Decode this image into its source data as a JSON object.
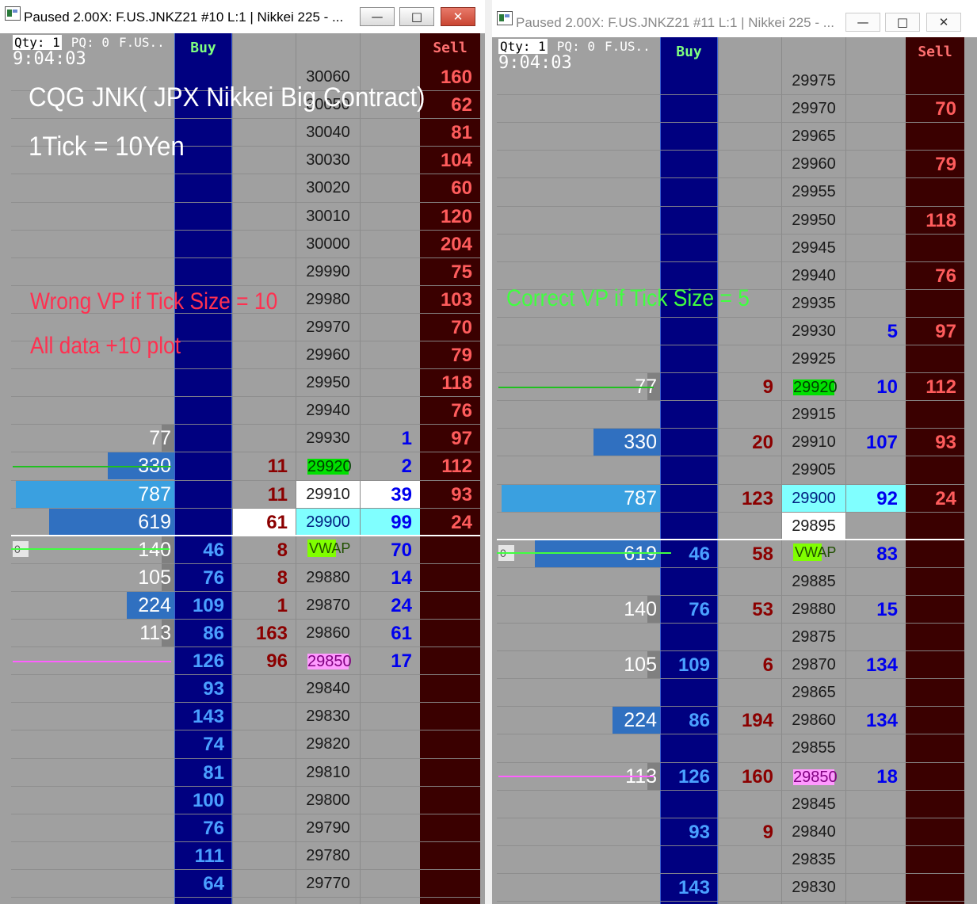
{
  "left": {
    "title": "Paused 2.00X: F.US.JNKZ21  #10 L:1 | Nikkei 225 - ...",
    "qty": "Qty: 1",
    "pq": "PQ: 0",
    "symbol": "F.US..",
    "clock": "9:04:03",
    "buy_label": "Buy",
    "sell_label": "Sell",
    "overlay_title": "CQG JNK( JPX Nikkei Big Contract)",
    "overlay_tick": "1Tick = 10Yen",
    "overlay_wrong": "Wrong VP if Tick Size = 10",
    "overlay_plot": "All data +10 plot",
    "rows": [
      {
        "price": "30060",
        "sell": "160"
      },
      {
        "price": "30050",
        "sell": "62"
      },
      {
        "price": "30040",
        "sell": "81"
      },
      {
        "price": "30030",
        "sell": "104"
      },
      {
        "price": "30020",
        "sell": "60"
      },
      {
        "price": "30010",
        "sell": "120"
      },
      {
        "price": "30000",
        "sell": "204"
      },
      {
        "price": "29990",
        "sell": "75"
      },
      {
        "price": "29980",
        "sell": "103"
      },
      {
        "price": "29970",
        "sell": "70"
      },
      {
        "price": "29960",
        "sell": "79"
      },
      {
        "price": "29950",
        "sell": "118"
      },
      {
        "price": "29940",
        "sell": "76"
      },
      {
        "price": "29930",
        "sell": "97",
        "ask": "1",
        "vol": "77",
        "vol_frac": 0.0
      },
      {
        "price": "29920",
        "sell": "112",
        "ask": "2",
        "bidtr": "11",
        "vol": "330",
        "vol_frac": 0.42,
        "hl": "green"
      },
      {
        "price": "29910",
        "sell": "93",
        "ask": "39",
        "bidtr": "11",
        "vol": "787",
        "vol_frac": 1.0,
        "hl": "white"
      },
      {
        "price": "29900",
        "sell": "24",
        "ask": "99",
        "bidtr": "61",
        "vol": "619",
        "vol_frac": 0.79,
        "hl": "cyan"
      },
      {
        "price": "VWAP",
        "ask": "70",
        "bidtr": "8",
        "buy": "46",
        "vol": "140",
        "vol_frac": 0.0,
        "hl": "vwap",
        "zero": "0"
      },
      {
        "price": "29880",
        "ask": "14",
        "bidtr": "8",
        "buy": "76",
        "vol": "105",
        "vol_frac": 0.0
      },
      {
        "price": "29870",
        "ask": "24",
        "bidtr": "1",
        "buy": "109",
        "vol": "224",
        "vol_frac": 0.28
      },
      {
        "price": "29860",
        "ask": "61",
        "bidtr": "163",
        "buy": "86",
        "vol": "113",
        "vol_frac": 0.0
      },
      {
        "price": "29850",
        "ask": "17",
        "bidtr": "96",
        "buy": "126",
        "hl": "pink"
      },
      {
        "price": "29840",
        "buy": "93"
      },
      {
        "price": "29830",
        "buy": "143"
      },
      {
        "price": "29820",
        "buy": "74"
      },
      {
        "price": "29810",
        "buy": "81"
      },
      {
        "price": "29800",
        "buy": "100"
      },
      {
        "price": "29790",
        "buy": "76"
      },
      {
        "price": "29780",
        "buy": "111"
      },
      {
        "price": "29770",
        "buy": "64"
      }
    ]
  },
  "right": {
    "title": "Paused 2.00X: F.US.JNKZ21  #11 L:1 | Nikkei 225 - ...",
    "qty": "Qty: 1",
    "pq": "PQ: 0",
    "symbol": "F.US..",
    "clock": "9:04:03",
    "buy_label": "Buy",
    "sell_label": "Sell",
    "overlay_correct": "Correct VP if Tick Size = 5",
    "rows": [
      {
        "price": "29975"
      },
      {
        "price": "29970",
        "sell": "70"
      },
      {
        "price": "29965"
      },
      {
        "price": "29960",
        "sell": "79"
      },
      {
        "price": "29955"
      },
      {
        "price": "29950",
        "sell": "118"
      },
      {
        "price": "29945"
      },
      {
        "price": "29940",
        "sell": "76"
      },
      {
        "price": "29935"
      },
      {
        "price": "29930",
        "sell": "97",
        "ask": "5"
      },
      {
        "price": "29925"
      },
      {
        "price": "29920",
        "sell": "112",
        "ask": "10",
        "bidtr": "9",
        "vol": "77",
        "vol_frac": 0.0,
        "hl": "green"
      },
      {
        "price": "29915"
      },
      {
        "price": "29910",
        "sell": "93",
        "ask": "107",
        "bidtr": "20",
        "vol": "330",
        "vol_frac": 0.42
      },
      {
        "price": "29905"
      },
      {
        "price": "29900",
        "sell": "24",
        "ask": "92",
        "bidtr": "123",
        "vol": "787",
        "vol_frac": 1.0,
        "hl": "cyan"
      },
      {
        "price": "29895",
        "hl": "white"
      },
      {
        "price": "VWAP",
        "ask": "83",
        "bidtr": "58",
        "buy": "46",
        "vol": "619",
        "vol_frac": 0.79,
        "hl": "vwap",
        "zero": "0"
      },
      {
        "price": "29885"
      },
      {
        "price": "29880",
        "ask": "15",
        "bidtr": "53",
        "buy": "76",
        "vol": "140",
        "vol_frac": 0.0
      },
      {
        "price": "29875"
      },
      {
        "price": "29870",
        "ask": "134",
        "bidtr": "6",
        "buy": "109",
        "vol": "105",
        "vol_frac": 0.0
      },
      {
        "price": "29865"
      },
      {
        "price": "29860",
        "ask": "134",
        "bidtr": "194",
        "buy": "86",
        "vol": "224",
        "vol_frac": 0.28
      },
      {
        "price": "29855"
      },
      {
        "price": "29850",
        "ask": "18",
        "bidtr": "160",
        "buy": "126",
        "vol": "113",
        "vol_frac": 0.0,
        "hl": "pink"
      },
      {
        "price": "29845"
      },
      {
        "price": "29840",
        "bidtr": "9",
        "buy": "93"
      },
      {
        "price": "29835"
      },
      {
        "price": "29830",
        "buy": "143"
      }
    ]
  }
}
